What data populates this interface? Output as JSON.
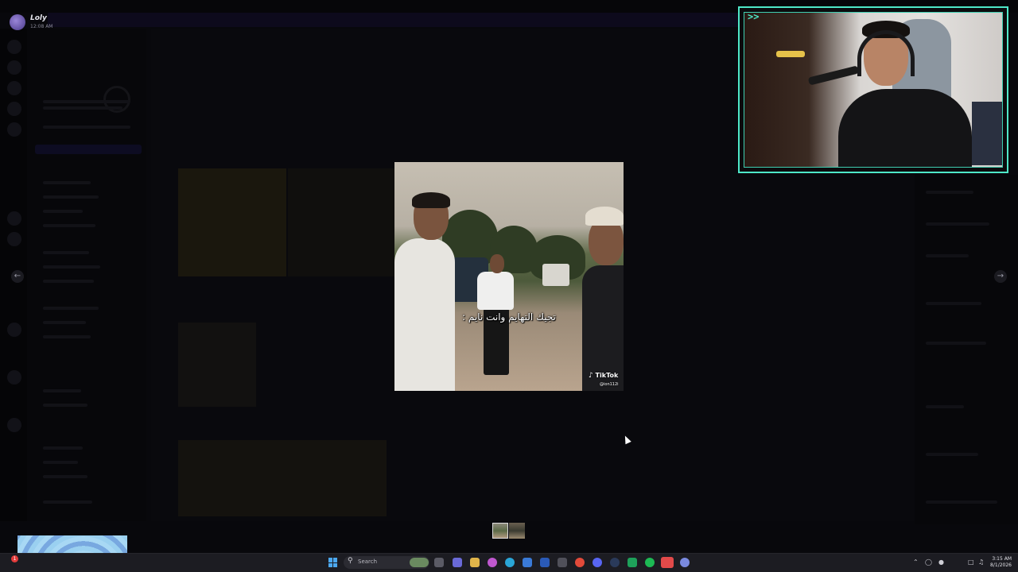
{
  "user": {
    "name": "Loly",
    "status_time": "12:08 AM"
  },
  "viewer": {
    "subtitle": "تجيك التهايم وانت نايم :",
    "watermark_brand": "TikTok",
    "watermark_handle": "@ion112i",
    "prev_icon": "arrow-left-icon",
    "next_icon": "arrow-right-icon"
  },
  "webcam": {
    "badge": ">>"
  },
  "notification": {
    "count": "1"
  },
  "taskbar": {
    "search_placeholder": "Search",
    "time": "3:15 AM",
    "date": "8/1/2026",
    "apps": [
      "file-explorer-icon",
      "teams-icon",
      "folder-icon",
      "edge-icon",
      "store-icon",
      "calendar-icon",
      "steam-icon",
      "chrome-icon",
      "discord-icon",
      "spotify-icon",
      "terminal-icon"
    ],
    "accent": "#4ca8f0"
  },
  "colors": {
    "webcam_border": "#4ee8c8",
    "badge_red": "#e23b3b"
  }
}
